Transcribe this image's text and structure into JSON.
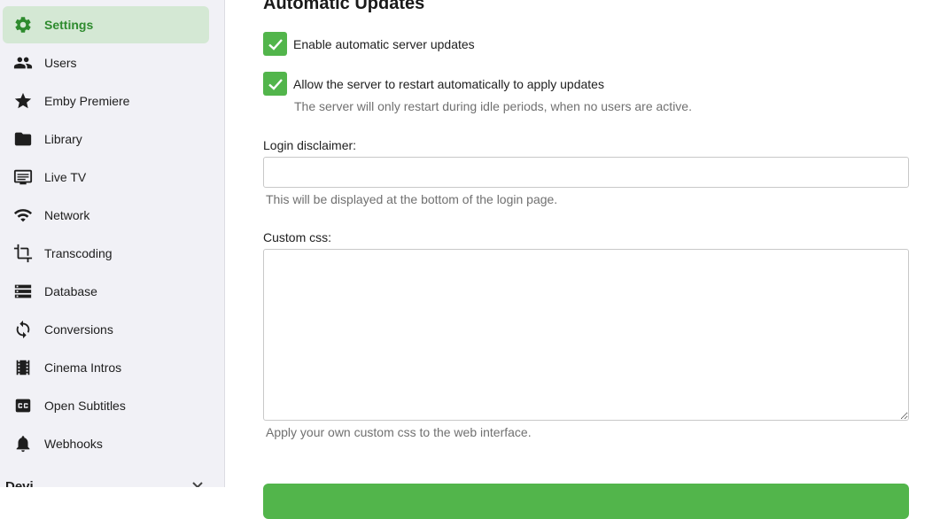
{
  "sidebar": {
    "items": [
      {
        "label": "Settings",
        "icon": "gear-icon",
        "active": true
      },
      {
        "label": "Users",
        "icon": "people-icon",
        "active": false
      },
      {
        "label": "Emby Premiere",
        "icon": "star-icon",
        "active": false
      },
      {
        "label": "Library",
        "icon": "folder-icon",
        "active": false
      },
      {
        "label": "Live TV",
        "icon": "tv-icon",
        "active": false
      },
      {
        "label": "Network",
        "icon": "wifi-icon",
        "active": false
      },
      {
        "label": "Transcoding",
        "icon": "crop-icon",
        "active": false
      },
      {
        "label": "Database",
        "icon": "database-icon",
        "active": false
      },
      {
        "label": "Conversions",
        "icon": "sync-icon",
        "active": false
      },
      {
        "label": "Cinema Intros",
        "icon": "film-icon",
        "active": false
      },
      {
        "label": "Open Subtitles",
        "icon": "closed-caption-icon",
        "active": false
      },
      {
        "label": "Webhooks",
        "icon": "bell-icon",
        "active": false
      }
    ],
    "next_section_partial": "Devi"
  },
  "main": {
    "heading": "Automatic Updates",
    "auto_update": {
      "label": "Enable automatic server updates",
      "checked": true
    },
    "auto_restart": {
      "label": "Allow the server to restart automatically to apply updates",
      "checked": true,
      "help": "The server will only restart during idle periods, when no users are active."
    },
    "login_disclaimer": {
      "label": "Login disclaimer:",
      "value": "",
      "help": "This will be displayed at the bottom of the login page."
    },
    "custom_css": {
      "label": "Custom css:",
      "value": "",
      "help": "Apply your own custom css to the web interface."
    }
  },
  "colors": {
    "accent": "#52b54b",
    "active_bg": "#d4e8d4",
    "active_text": "#2e8b2e",
    "sidebar_bg": "#f1f1f6"
  }
}
